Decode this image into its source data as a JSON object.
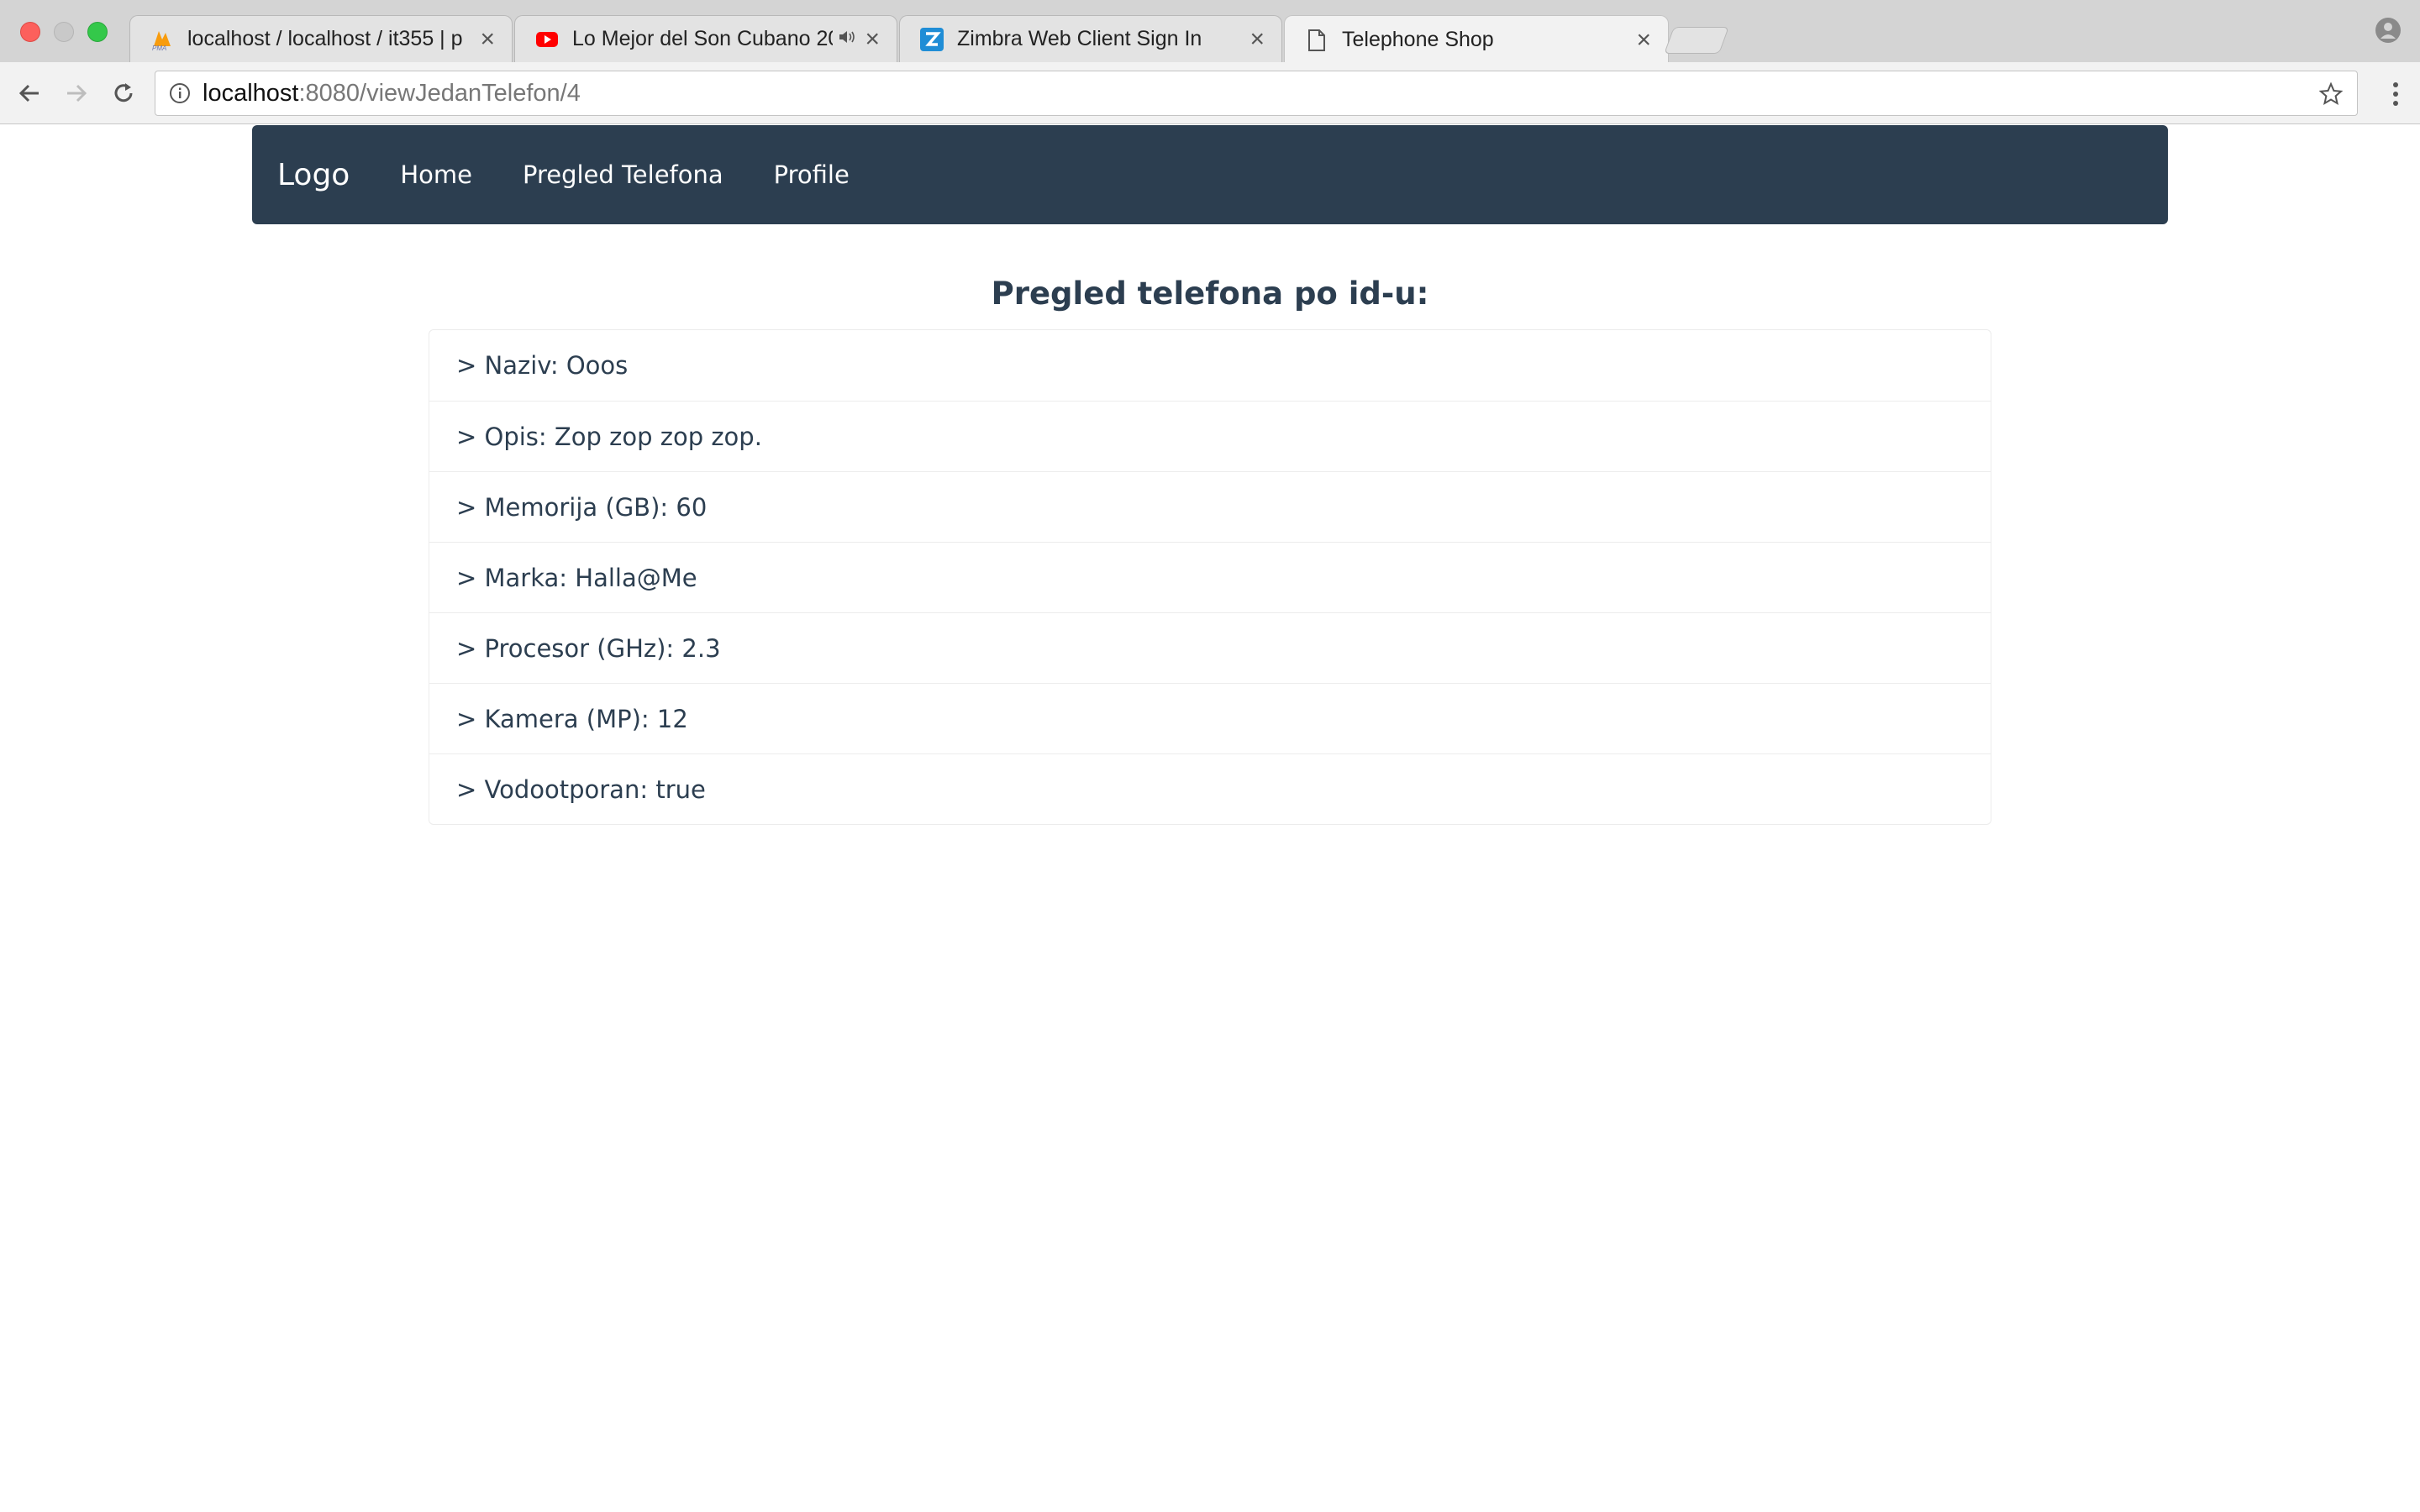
{
  "browser": {
    "tabs": [
      {
        "title": "localhost / localhost / it355 | p",
        "icon": "phpmyadmin-icon",
        "active": false
      },
      {
        "title": "Lo Mejor del Son Cubano 20",
        "icon": "youtube-icon",
        "active": false,
        "audio": true
      },
      {
        "title": "Zimbra Web Client Sign In",
        "icon": "zimbra-icon",
        "active": false
      },
      {
        "title": "Telephone Shop",
        "icon": "document-icon",
        "active": true
      }
    ],
    "close_glyph": "×",
    "url_host": "localhost",
    "url_path": ":8080/viewJedanTelefon/4"
  },
  "navbar": {
    "brand": "Logo",
    "links": [
      "Home",
      "Pregled Telefona",
      "Profile"
    ],
    "background": "#2c3e50"
  },
  "main": {
    "heading": "Pregled telefona po id-u:",
    "items": [
      "> Naziv: Ooos",
      "> Opis: Zop zop zop zop.",
      "> Memorija (GB): 60",
      "> Marka: Halla@Me",
      "> Procesor (GHz): 2.3",
      "> Kamera (MP): 12",
      "> Vodootporan: true"
    ]
  }
}
